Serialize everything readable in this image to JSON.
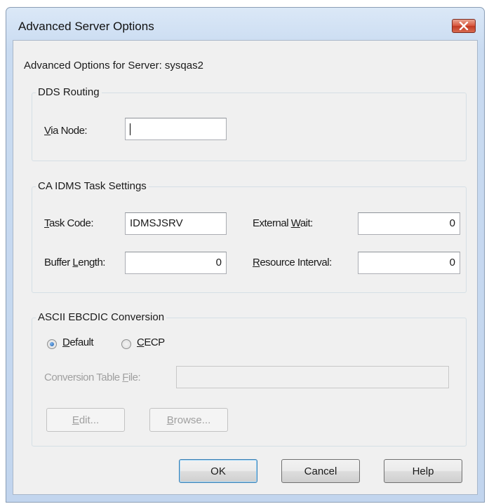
{
  "window": {
    "title": "Advanced Server Options"
  },
  "server_label": "Advanced Options for Server: sysqas2",
  "dds_routing": {
    "title": "DDS Routing",
    "via_node": {
      "label_u": "V",
      "label_rest": "ia Node:",
      "value": ""
    }
  },
  "task_settings": {
    "title": "CA IDMS Task Settings",
    "task_code": {
      "label_u": "T",
      "label_rest": "ask Code:",
      "value": "IDMSJSRV"
    },
    "buffer_length": {
      "label_pre": "Buffer ",
      "label_u": "L",
      "label_rest": "ength:",
      "value": "0"
    },
    "external_wait": {
      "label_pre": "External ",
      "label_u": "W",
      "label_rest": "ait:",
      "value": "0"
    },
    "resource_interval": {
      "label_u": "R",
      "label_rest": "esource Interval:",
      "value": "0"
    }
  },
  "conversion": {
    "title": "ASCII EBCDIC Conversion",
    "default_option": {
      "label_u": "D",
      "label_rest": "efault",
      "selected": true
    },
    "cecp_option": {
      "label_u": "C",
      "label_rest": "ECP",
      "selected": false
    },
    "table_file": {
      "label_pre": "Conversion Table ",
      "label_u": "F",
      "label_rest": "ile:",
      "value": ""
    },
    "edit_button": {
      "label_u": "E",
      "label_rest": "dit..."
    },
    "browse_button": {
      "label_u": "B",
      "label_rest": "rowse..."
    }
  },
  "buttons": {
    "ok": "OK",
    "cancel": "Cancel",
    "help": "Help"
  },
  "colors": {
    "close_button": "#c94a32",
    "window_frame": "#c6d8ef",
    "dialog_bg": "#f0f0f0",
    "default_button_border": "#3c7fb1"
  }
}
